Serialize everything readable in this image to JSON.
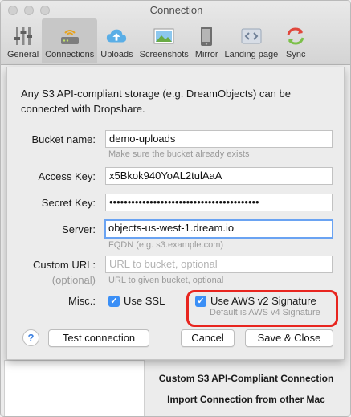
{
  "window": {
    "title": "Connection"
  },
  "toolbar": {
    "tabs": [
      {
        "label": "General",
        "icon": "sliders-icon"
      },
      {
        "label": "Connections",
        "icon": "router-icon"
      },
      {
        "label": "Uploads",
        "icon": "cloud-upload-icon"
      },
      {
        "label": "Screenshots",
        "icon": "photo-icon"
      },
      {
        "label": "Mirror",
        "icon": "phone-icon"
      },
      {
        "label": "Landing page",
        "icon": "code-icon"
      },
      {
        "label": "Sync",
        "icon": "sync-icon"
      }
    ],
    "active_tab": "Connections"
  },
  "sheet": {
    "intro": "Any S3 API-compliant storage (e.g. DreamObjects) can be connected with Dropshare.",
    "bucket": {
      "label": "Bucket name:",
      "value": "demo-uploads",
      "help": "Make sure the bucket already exists"
    },
    "access_key": {
      "label": "Access Key:",
      "value": "x5Bkok940YoAL2tulAaA"
    },
    "secret_key": {
      "label": "Secret Key:",
      "value": "•••••••••••••••••••••••••••••••••••••••••"
    },
    "server": {
      "label": "Server:",
      "value": "objects-us-west-1.dream.io",
      "help": "FQDN (e.g. s3.example.com)"
    },
    "custom_url": {
      "label": "Custom URL:",
      "sublabel": "(optional)",
      "placeholder": "URL to bucket, optional",
      "help": "URL to given bucket, optional"
    },
    "misc": {
      "label": "Misc.:",
      "use_ssl": {
        "label": "Use SSL",
        "checked": true
      },
      "aws_v2": {
        "label": "Use AWS v2 Signature",
        "checked": true,
        "help": "Default is AWS v4 Signature"
      }
    },
    "buttons": {
      "help": "?",
      "test": "Test connection",
      "cancel": "Cancel",
      "save": "Save & Close"
    }
  },
  "background": {
    "options": [
      "Custom S3 API-Compliant Connection",
      "Import Connection from other Mac"
    ]
  },
  "colors": {
    "accent": "#3b8ff6",
    "highlight": "#e8251f",
    "focus_ring": "#6aa3f2"
  }
}
